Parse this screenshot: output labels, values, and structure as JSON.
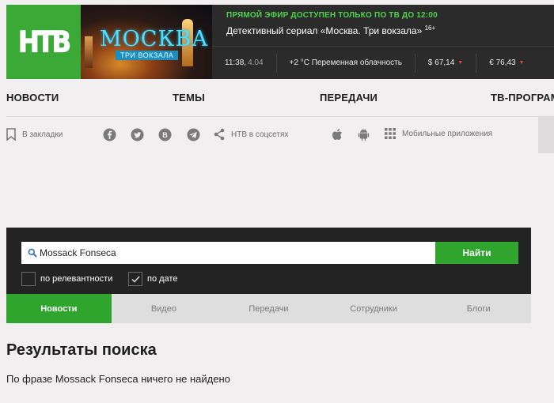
{
  "header": {
    "logo_text": "НТВ",
    "promo": {
      "title": "МОСКВА",
      "subtitle": "ТРИ ВОКЗАЛА"
    },
    "live_label": "ПРЯМОЙ ЭФИР ДОСТУПЕН ТОЛЬКО ПО ТВ ДО 12:00",
    "live_show": "Детективный сериал «Москва. Три вокзала»",
    "age_rating": "16+",
    "time": "11:38,",
    "date": "4.04",
    "weather": "+2 °C Переменная облачность",
    "usd": "$ 67,14",
    "eur": "€ 76,43",
    "rate_arrow": "▼"
  },
  "nav": {
    "items": [
      "НОВОСТИ",
      "ТЕМЫ",
      "ПЕРЕДАЧИ",
      "ТВ-ПРОГРАММА"
    ]
  },
  "social": {
    "bookmarks": "В закладки",
    "ntv_social": "НТВ в соцсетях",
    "mobile_apps": "Мобильные приложения"
  },
  "search": {
    "query": "Mossack Fonseca",
    "button": "Найти",
    "opt_relevance": "по релевантности",
    "opt_date": "по дате",
    "date_checked": true
  },
  "tabs": [
    "Новости",
    "Видео",
    "Передачи",
    "Сотрудники",
    "Блоги"
  ],
  "results": {
    "title": "Результаты поиска",
    "message": "По фразе Mossack Fonseca ничего не найдено"
  },
  "colors": {
    "brand_green": "#2fa52d",
    "header_dark": "#2b2b2b",
    "live_green": "#4fd34a",
    "down_red": "#e24b3b"
  }
}
